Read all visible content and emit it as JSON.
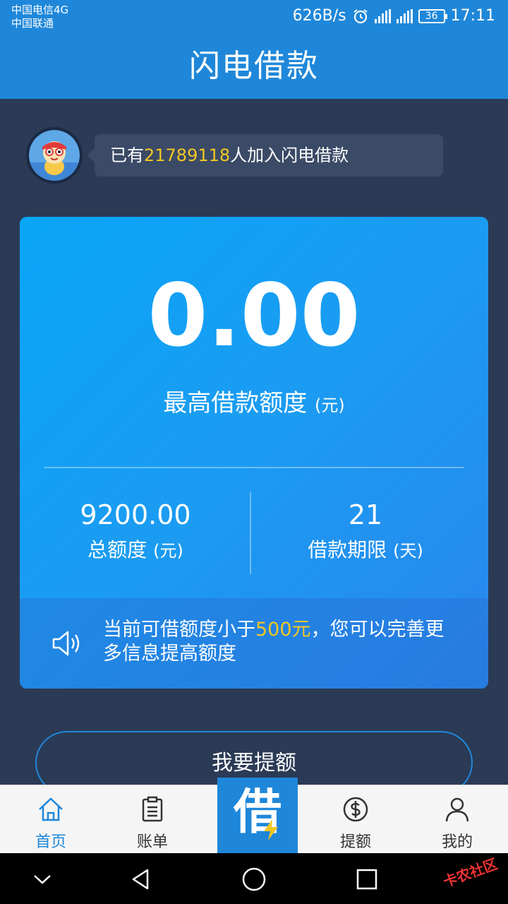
{
  "status": {
    "carrier_1": "中国电信4G",
    "carrier_2": "中国联通",
    "net_speed": "626B/s",
    "battery": "36",
    "time": "17:11"
  },
  "header": {
    "title": "闪电借款"
  },
  "banner": {
    "prefix": "已有",
    "count": "21789118",
    "suffix": "人加入闪电借款"
  },
  "card": {
    "amount": "0.00",
    "amount_label": "最高借款额度",
    "amount_unit": "(元)",
    "total_value": "9200.00",
    "total_label": "总额度",
    "total_unit": "(元)",
    "term_value": "21",
    "term_label": "借款期限",
    "term_unit": "(天)",
    "notice_prefix": "当前可借额度小于",
    "notice_highlight": "500元",
    "notice_suffix": "，您可以完善更多信息提高额度"
  },
  "raise_button": "我要提额",
  "tabs": [
    {
      "label": "首页",
      "icon": "home-icon"
    },
    {
      "label": "账单",
      "icon": "bill-icon"
    },
    {
      "label": "借",
      "icon": "lightning-icon"
    },
    {
      "label": "提额",
      "icon": "dollar-icon"
    },
    {
      "label": "我的",
      "icon": "user-icon"
    }
  ],
  "watermark": "卡农社区",
  "colors": {
    "brand_blue": "#1f87d9",
    "background": "#2b3a55",
    "highlight": "#f3c623"
  }
}
